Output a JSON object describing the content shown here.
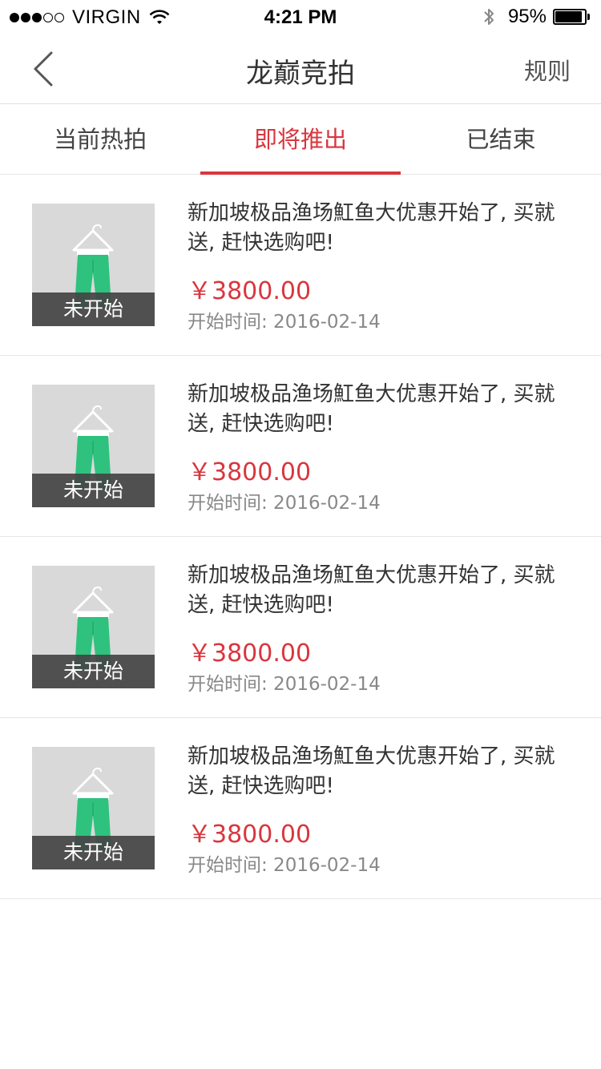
{
  "status_bar": {
    "carrier": "VIRGIN",
    "time": "4:21 PM",
    "battery": "95%"
  },
  "nav": {
    "title": "龙巅竞拍",
    "rules_label": "规则"
  },
  "tabs": [
    {
      "label": "当前热拍",
      "active": false
    },
    {
      "label": "即将推出",
      "active": true
    },
    {
      "label": "已结束",
      "active": false
    }
  ],
  "items": [
    {
      "badge": "未开始",
      "title": "新加坡极品渔场魟鱼大优惠开始了, 买就送, 赶快选购吧!",
      "price": "￥3800.00",
      "start_time": "开始时间: 2016-02-14"
    },
    {
      "badge": "未开始",
      "title": "新加坡极品渔场魟鱼大优惠开始了, 买就送, 赶快选购吧!",
      "price": "￥3800.00",
      "start_time": "开始时间: 2016-02-14"
    },
    {
      "badge": "未开始",
      "title": "新加坡极品渔场魟鱼大优惠开始了, 买就送, 赶快选购吧!",
      "price": "￥3800.00",
      "start_time": "开始时间: 2016-02-14"
    },
    {
      "badge": "未开始",
      "title": "新加坡极品渔场魟鱼大优惠开始了, 买就送, 赶快选购吧!",
      "price": "￥3800.00",
      "start_time": "开始时间: 2016-02-14"
    }
  ],
  "colors": {
    "accent": "#d9363e",
    "product_green": "#2ec27e"
  }
}
